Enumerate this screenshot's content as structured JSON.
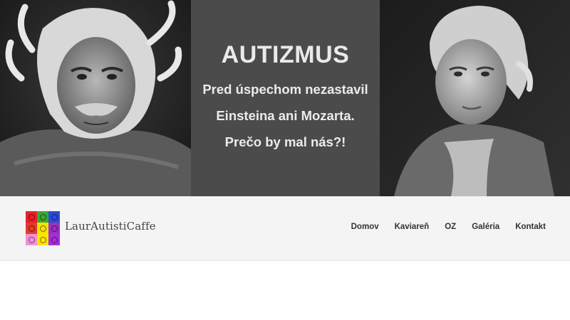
{
  "hero": {
    "headline": "AUTIZMUS",
    "line1": "Pred úspechom nezastavil",
    "line2": "Einsteina ani Mozarta.",
    "line3": "Prečo by mal nás?!"
  },
  "header": {
    "site_title": "LaurAutistiCaffe",
    "logo_colors": [
      "#e8202a",
      "#3aa935",
      "#2c4bd6",
      "#e23b2a",
      "#f7e200",
      "#9b2fc4",
      "#f58fd5",
      "#ffe600",
      "#a32fd8"
    ]
  },
  "nav": {
    "items": [
      {
        "label": "Domov"
      },
      {
        "label": "Kaviareň"
      },
      {
        "label": "OZ"
      },
      {
        "label": "Galéria"
      },
      {
        "label": "Kontakt"
      }
    ]
  },
  "colors": {
    "hero_panel": "#4b4b4b",
    "navbar_bg": "#f4f4f4"
  }
}
